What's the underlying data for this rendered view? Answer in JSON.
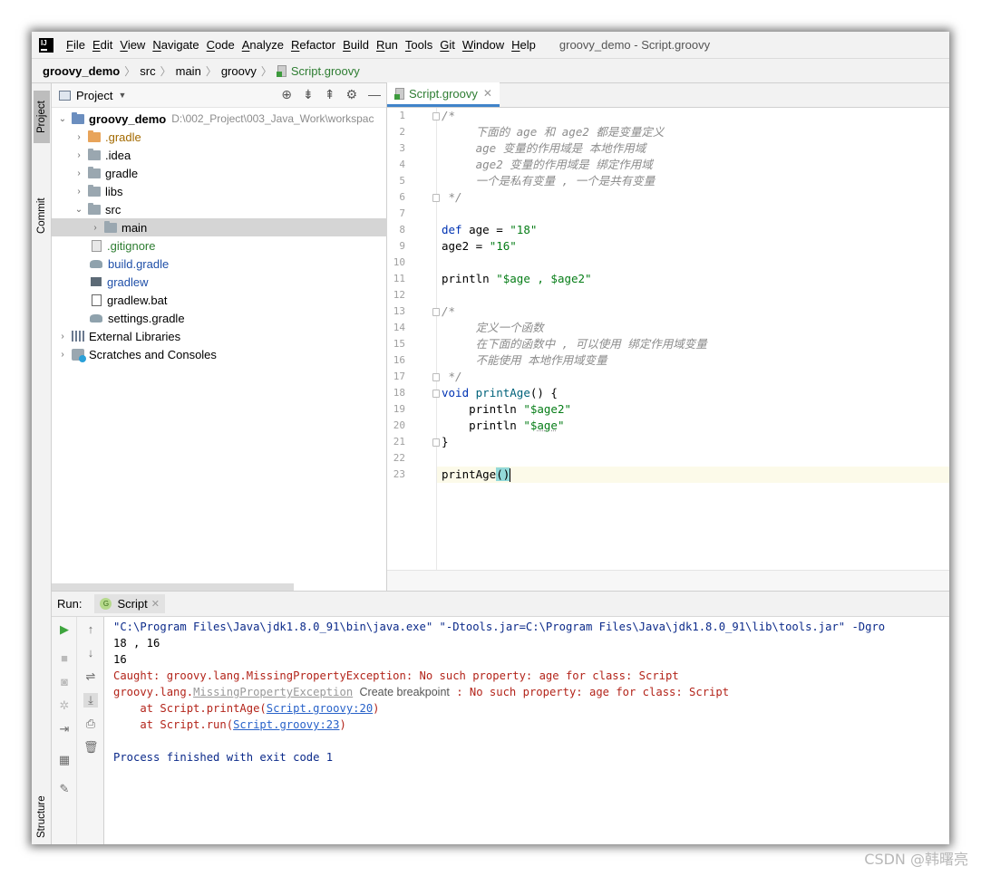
{
  "menubar": {
    "items": [
      "File",
      "Edit",
      "View",
      "Navigate",
      "Code",
      "Analyze",
      "Refactor",
      "Build",
      "Run",
      "Tools",
      "Git",
      "Window",
      "Help"
    ],
    "window_title": "groovy_demo - Script.groovy"
  },
  "breadcrumb": [
    "groovy_demo",
    "src",
    "main",
    "groovy",
    "Script.groovy"
  ],
  "left_strip": {
    "project_tab": "Project",
    "commit_tab": "Commit",
    "structure_tab": "Structure"
  },
  "project_panel": {
    "title": "Project",
    "tree": [
      {
        "label": "groovy_demo",
        "path": "D:\\002_Project\\003_Java_Work\\workspac"
      },
      {
        "label": ".gradle"
      },
      {
        "label": ".idea"
      },
      {
        "label": "gradle"
      },
      {
        "label": "libs"
      },
      {
        "label": "src"
      },
      {
        "label": "main"
      },
      {
        "label": ".gitignore"
      },
      {
        "label": "build.gradle"
      },
      {
        "label": "gradlew"
      },
      {
        "label": "gradlew.bat"
      },
      {
        "label": "settings.gradle"
      },
      {
        "label": "External Libraries"
      },
      {
        "label": "Scratches and Consoles"
      }
    ]
  },
  "editor": {
    "tab_label": "Script.groovy",
    "line_numbers": [
      "1",
      "2",
      "3",
      "4",
      "5",
      "6",
      "7",
      "8",
      "9",
      "10",
      "11",
      "12",
      "13",
      "14",
      "15",
      "16",
      "17",
      "18",
      "19",
      "20",
      "21",
      "22",
      "23"
    ],
    "lines": [
      "/*",
      "     下面的 age 和 age2 都是变量定义",
      "     age 变量的作用域是 本地作用域",
      "     age2 变量的作用域是 绑定作用域",
      "     一个是私有变量 , 一个是共有变量",
      " */",
      "",
      "def age = \"18\"",
      "age2 = \"16\"",
      "",
      "println \"$age , $age2\"",
      "",
      "/*",
      "     定义一个函数",
      "     在下面的函数中 , 可以使用 绑定作用域变量",
      "     不能使用 本地作用域变量",
      " */",
      "void printAge() {",
      "    println \"$age2\"",
      "    println \"$age\"",
      "}",
      "",
      "printAge()"
    ]
  },
  "run_panel": {
    "label": "Run:",
    "tab_label": "Script",
    "console": {
      "cmd": "\"C:\\Program Files\\Java\\jdk1.8.0_91\\bin\\java.exe\" \"-Dtools.jar=C:\\Program Files\\Java\\jdk1.8.0_91\\lib\\tools.jar\" -Dgro",
      "out1": "18 , 16",
      "out2": "16",
      "err1": "Caught: groovy.lang.MissingPropertyException: No such property: age for class: Script",
      "err2_prefix": "groovy.lang.",
      "err2_link": "MissingPropertyException",
      "err2_hint": "Create breakpoint",
      "err2_suffix": " : No such property: age for class: Script",
      "trace1_prefix": "    at Script.printAge(",
      "trace1_link": "Script.groovy:20",
      "trace1_suffix": ")",
      "trace2_prefix": "    at Script.run(",
      "trace2_link": "Script.groovy:23",
      "trace2_suffix": ")",
      "finished": "Process finished with exit code 1"
    }
  },
  "watermark": "CSDN @韩曙亮"
}
